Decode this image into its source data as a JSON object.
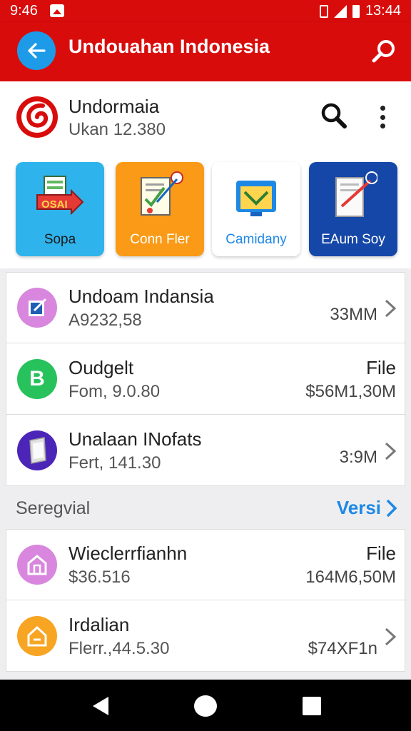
{
  "status_bar": {
    "time": "9:46",
    "clock": "13:44"
  },
  "app_bar": {
    "title": "Undouahan Indonesia"
  },
  "header": {
    "name": "Undormaia",
    "subtitle": "Ukan 12.380"
  },
  "tiles": [
    {
      "label": "Sopa",
      "art_text": "OSAI",
      "bg": "#2fb3ec",
      "color": "#1a1a1a"
    },
    {
      "label": "Conn Fler",
      "bg": "#fa9a16",
      "color": "#ffffff"
    },
    {
      "label": "Camidany",
      "bg": "#ffffff",
      "color": "#1e88e5"
    },
    {
      "label": "EAum Soy",
      "bg": "#1547a8",
      "color": "#ffffff"
    }
  ],
  "list1": [
    {
      "title": "Undoam Indansia",
      "subtitle": "A9232,58",
      "size": "33MM",
      "icon_bg": "#d886de"
    },
    {
      "title": "Oudgelt",
      "subtitle": "Fom, 9.0.80",
      "side": "File",
      "size": "$56M1,30M",
      "icon_bg": "#27c25b",
      "icon_letter": "B"
    },
    {
      "title": "Unalaan INofats",
      "subtitle": "Fert, 141.30",
      "size": "3:9M",
      "icon_bg": "#4b25b8"
    }
  ],
  "section": {
    "title": "Seregvial",
    "link": "Versi"
  },
  "list2": [
    {
      "title": "Wieclerrfianhn",
      "subtitle": "$36.516",
      "side": "File",
      "size": "164M6,50M",
      "icon_bg": "#d886de"
    },
    {
      "title": "Irdalian",
      "subtitle": "Flerr.,44.5.30",
      "size": "$74XF1n",
      "icon_bg": "#f7a523"
    }
  ],
  "colors": {
    "primary": "#d90c0c",
    "accent": "#1e88e5",
    "back_button": "#1e9be8"
  }
}
